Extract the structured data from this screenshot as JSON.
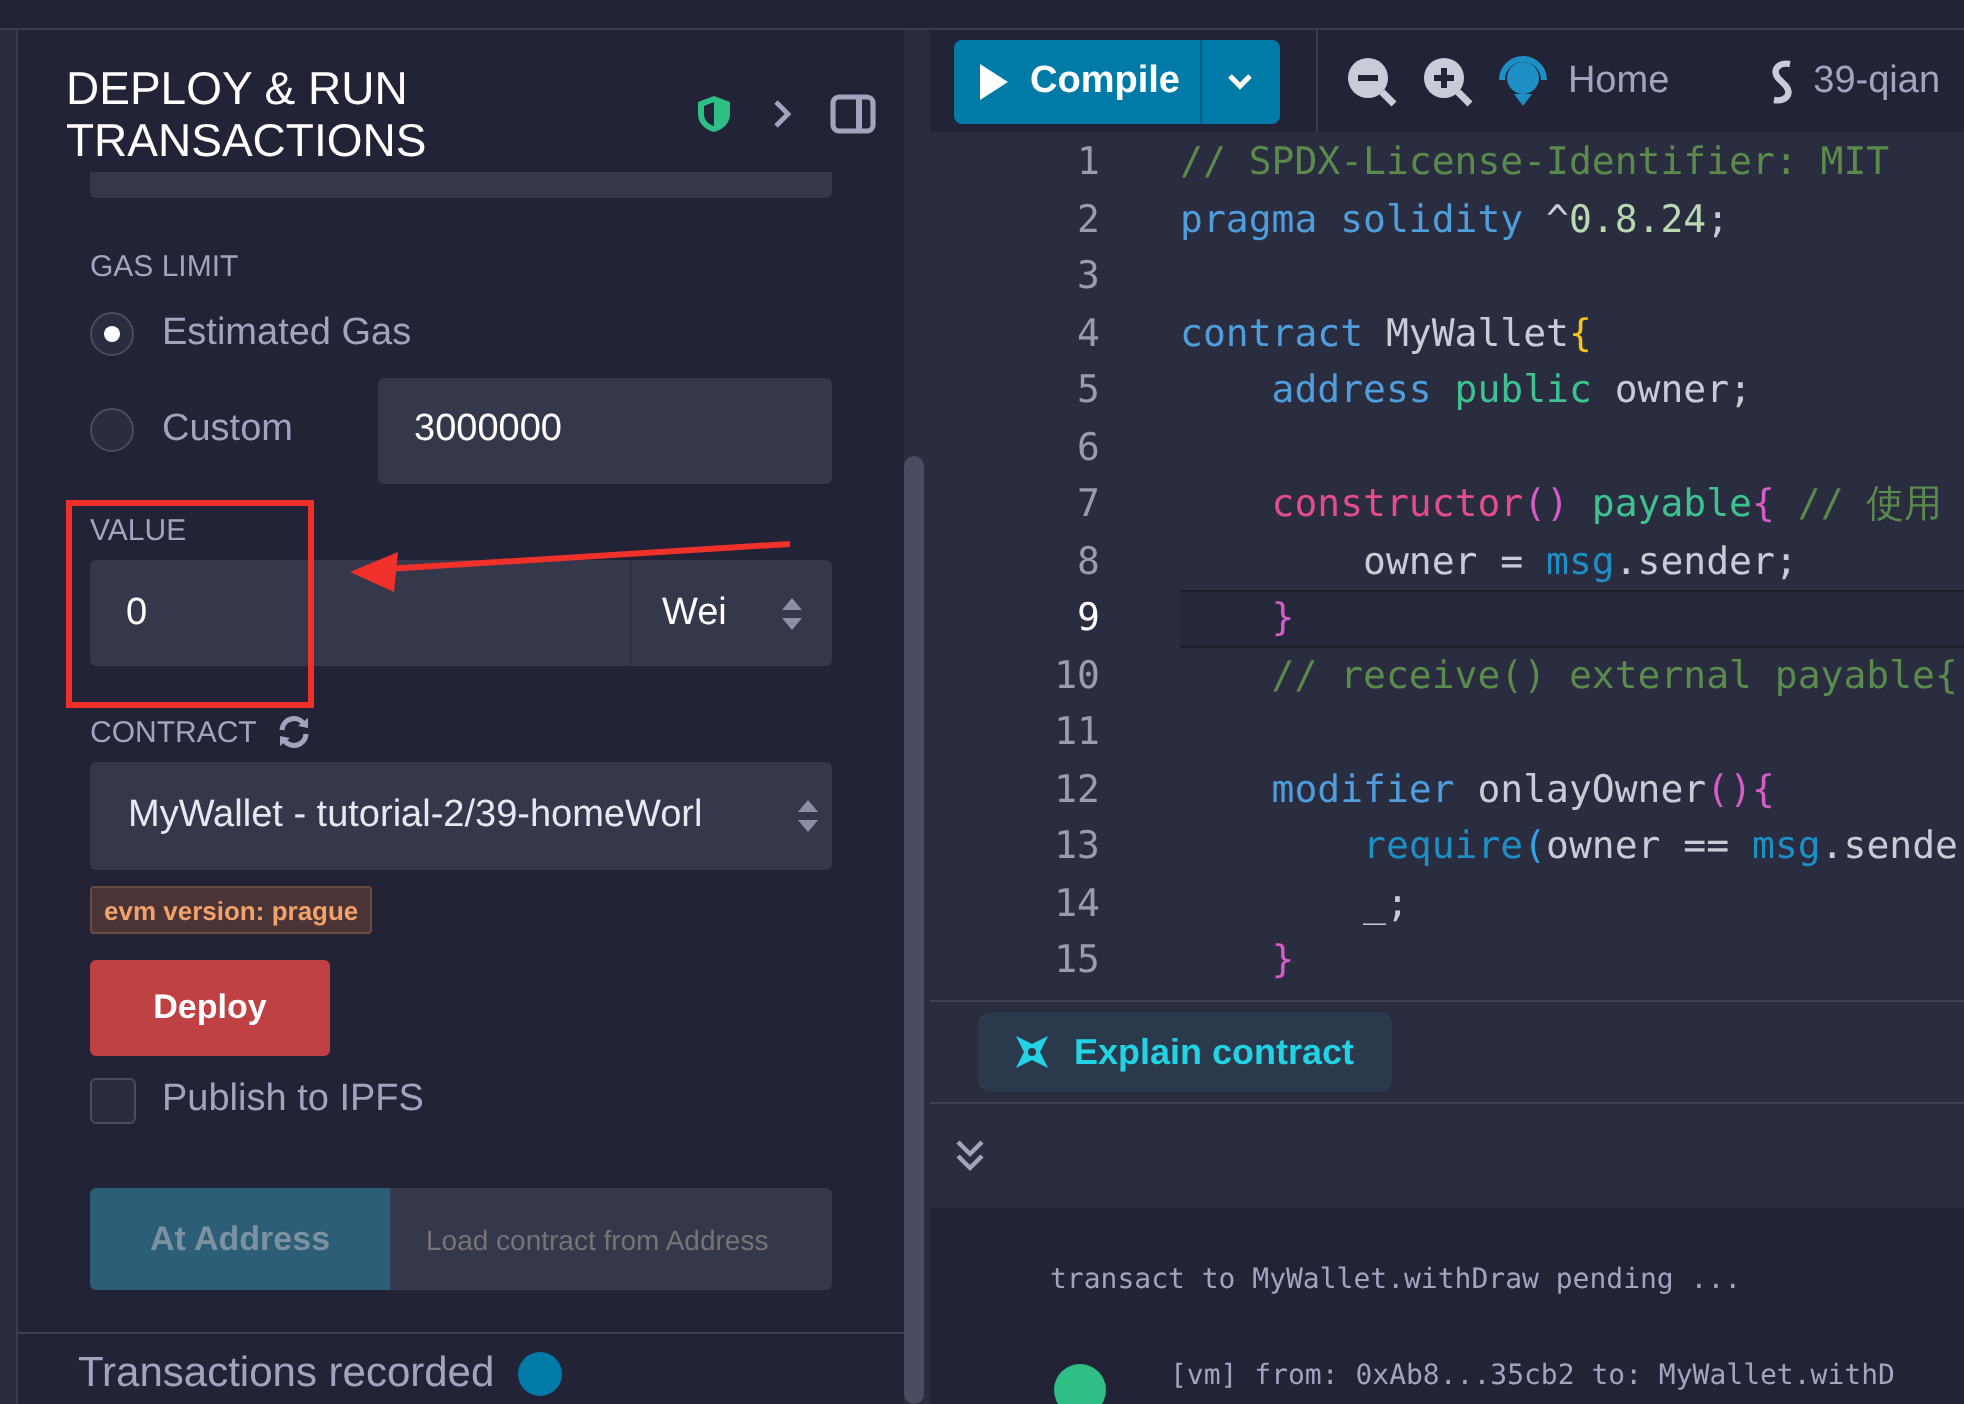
{
  "deploy_panel": {
    "title": "DEPLOY & RUN TRANSACTIONS",
    "gas_limit": {
      "label": "GAS LIMIT",
      "options": [
        {
          "label": "Estimated Gas",
          "selected": true
        },
        {
          "label": "Custom",
          "selected": false
        }
      ],
      "custom_value": "3000000"
    },
    "value": {
      "label": "VALUE",
      "value": "0",
      "unit": "Wei"
    },
    "contract": {
      "label": "CONTRACT",
      "selected_value": "MyWallet - tutorial-2/39-homeWorl"
    },
    "evm_badge": "evm version: prague",
    "deploy_button": "Deploy",
    "publish_ipfs": {
      "label": "Publish to IPFS",
      "checked": false
    },
    "at_address": {
      "button": "At Address",
      "placeholder": "Load contract from Address"
    },
    "transactions_recorded": "Transactions recorded"
  },
  "annotation": {
    "kind": "box-and-arrow"
  },
  "toolbar": {
    "compile": "Compile",
    "home": "Home",
    "workspace_tab": "39-qian"
  },
  "editor": {
    "lines": [
      {
        "number": "1",
        "current": false,
        "tokens": [
          {
            "text": "// SPDX-License-Identifier: MIT",
            "kind": "comment"
          }
        ]
      },
      {
        "number": "2",
        "current": false,
        "tokens": [
          {
            "text": "pragma solidity",
            "kind": "keyword"
          },
          {
            "text": " ^",
            "kind": "plain"
          },
          {
            "text": "0.8.24",
            "kind": "number"
          },
          {
            "text": ";",
            "kind": "plain"
          }
        ]
      },
      {
        "number": "3",
        "current": false
      },
      {
        "number": "4",
        "current": false,
        "tokens": [
          {
            "text": "contract",
            "kind": "keyword"
          },
          {
            "text": " MyWallet",
            "kind": "plain"
          },
          {
            "text": "{",
            "kind": "brace"
          }
        ]
      },
      {
        "number": "5",
        "current": false,
        "tokens": [
          {
            "text": "    address",
            "kind": "keyword"
          },
          {
            "text": " public",
            "kind": "modifier"
          },
          {
            "text": " owner;",
            "kind": "plain"
          }
        ]
      },
      {
        "number": "6",
        "current": false
      },
      {
        "number": "7",
        "current": false,
        "tokens": [
          {
            "text": "    constructor",
            "kind": "special"
          },
          {
            "text": "()",
            "kind": "paren"
          },
          {
            "text": " payable",
            "kind": "modifier"
          },
          {
            "text": "{",
            "kind": "paren"
          },
          {
            "text": " // 使用",
            "kind": "comment"
          }
        ]
      },
      {
        "number": "8",
        "current": false,
        "tokens": [
          {
            "text": "        owner = ",
            "kind": "plain"
          },
          {
            "text": "msg",
            "kind": "global"
          },
          {
            "text": ".sender;",
            "kind": "plain"
          }
        ]
      },
      {
        "number": "9",
        "current": true,
        "tokens": [
          {
            "text": "    }",
            "kind": "paren"
          }
        ]
      },
      {
        "number": "10",
        "current": false,
        "tokens": [
          {
            "text": "    // receive() external payable{",
            "kind": "comment"
          }
        ]
      },
      {
        "number": "11",
        "current": false
      },
      {
        "number": "12",
        "current": false,
        "tokens": [
          {
            "text": "    modifier",
            "kind": "keyword"
          },
          {
            "text": " onlayOwner",
            "kind": "plain"
          },
          {
            "text": "(){",
            "kind": "paren"
          }
        ]
      },
      {
        "number": "13",
        "current": false,
        "tokens": [
          {
            "text": "        require",
            "kind": "global"
          },
          {
            "text": "(",
            "kind": "call"
          },
          {
            "text": "owner == ",
            "kind": "plain"
          },
          {
            "text": "msg",
            "kind": "global"
          },
          {
            "text": ".sende",
            "kind": "plain"
          }
        ]
      },
      {
        "number": "14",
        "current": false,
        "tokens": [
          {
            "text": "        _;",
            "kind": "plain"
          }
        ]
      },
      {
        "number": "15",
        "current": false,
        "tokens": [
          {
            "text": "    }",
            "kind": "paren"
          }
        ]
      }
    ]
  },
  "explain_button": "Explain contract",
  "terminal": {
    "lines": [
      {
        "kind": "pending",
        "text": "transact to MyWallet.withDraw pending ..."
      },
      {
        "kind": "success",
        "text": "[vm]  from: 0xAb8...35cb2 to: MyWallet.withD"
      }
    ]
  }
}
